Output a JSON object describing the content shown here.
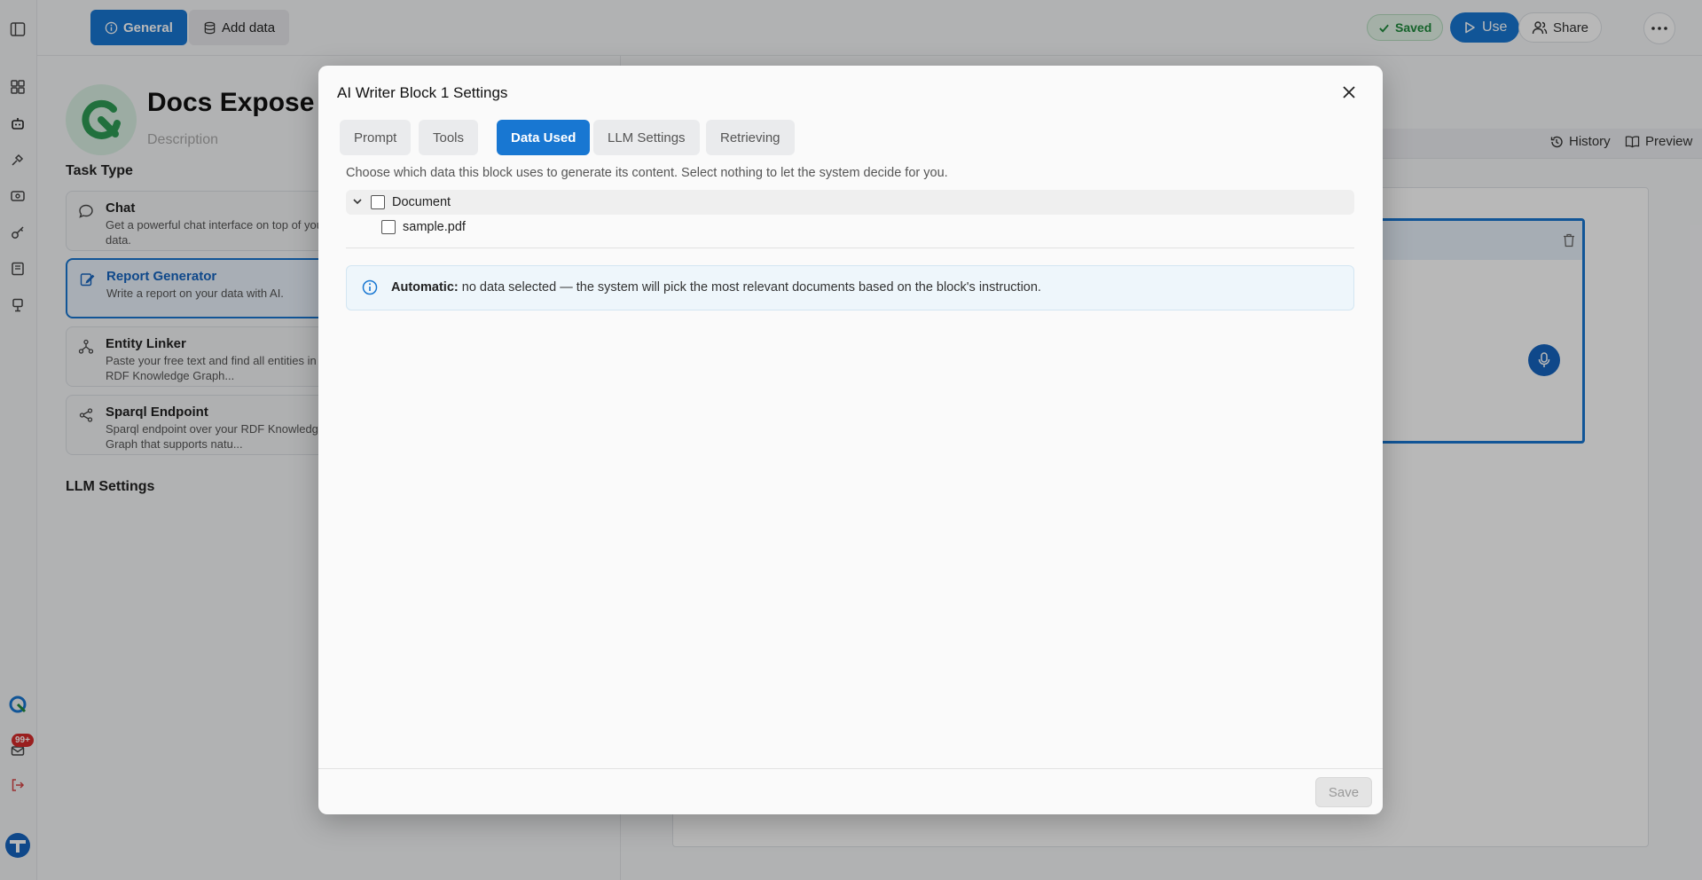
{
  "topbar": {
    "tab_general": "General",
    "tab_add_data": "Add data",
    "saved": "Saved",
    "use": "Use",
    "share": "Share"
  },
  "rail": {
    "notification_count": "99+"
  },
  "project": {
    "title": "Docs Expose S",
    "description": "Description"
  },
  "task_type": {
    "heading": "Task Type",
    "items": [
      {
        "name": "Chat",
        "desc": "Get a powerful chat interface on top of your data."
      },
      {
        "name": "Report Generator",
        "desc": "Write a report on your data with AI."
      },
      {
        "name": "Entity Linker",
        "desc": "Paste your free text and find all entities in your RDF Knowledge Graph..."
      },
      {
        "name": "Sparql Endpoint",
        "desc": "Sparql endpoint over your RDF Knowledge Graph that supports natu..."
      }
    ],
    "selected_index": 1
  },
  "llm_settings_heading": "LLM Settings",
  "preview": {
    "history": "History",
    "preview": "Preview"
  },
  "modal": {
    "title": "AI Writer Block 1 Settings",
    "tabs": [
      "Prompt",
      "Tools",
      "Data Used",
      "LLM Settings",
      "Retrieving"
    ],
    "active_tab": "Data Used",
    "hint": "Choose which data this block uses to generate its content. Select nothing to let the system decide for you.",
    "tree": {
      "group_label": "Document",
      "children": [
        "sample.pdf"
      ]
    },
    "info": {
      "label": "Automatic:",
      "text": " no data selected — the system will pick the most relevant documents based on the block's instruction."
    },
    "save": "Save"
  },
  "colors": {
    "accent": "#1877d2",
    "saved_green": "#1f8a3c",
    "badge_red": "#d62b2b"
  }
}
